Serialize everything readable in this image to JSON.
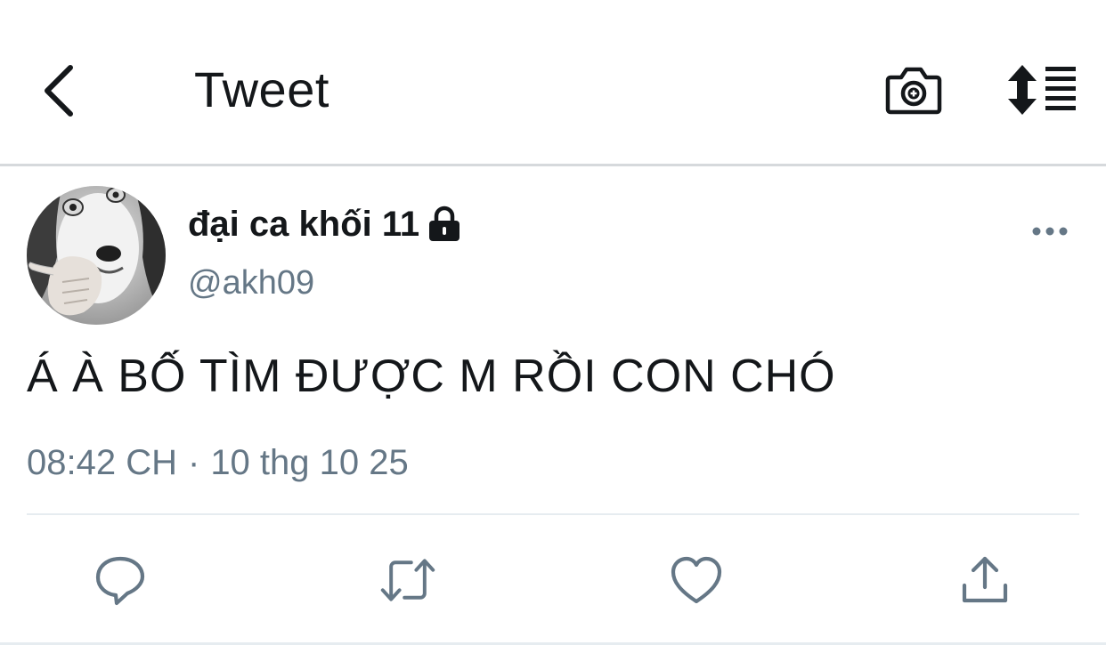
{
  "header": {
    "title": "Tweet",
    "back_icon": "chevron-left-icon",
    "camera_icon": "camera-add-icon",
    "sort_icon": "sort-list-icon"
  },
  "tweet": {
    "display_name": "đại ca khối 11",
    "handle": "@akh09",
    "protected_icon": "lock-icon",
    "more_icon": "more-horizontal-icon",
    "text": "Á À BỐ TÌM ĐƯỢC M RỒI CON CHÓ",
    "time": "08:42 CH",
    "separator": "·",
    "date": "10 thg 10 25"
  },
  "actions": [
    {
      "name": "reply",
      "icon": "reply-icon"
    },
    {
      "name": "retweet",
      "icon": "retweet-icon"
    },
    {
      "name": "like",
      "icon": "heart-icon"
    },
    {
      "name": "share",
      "icon": "share-icon"
    }
  ],
  "colors": {
    "text_primary": "#14171a",
    "text_secondary": "#657786",
    "icon_gray": "#657786",
    "divider": "#e6ecf0"
  }
}
